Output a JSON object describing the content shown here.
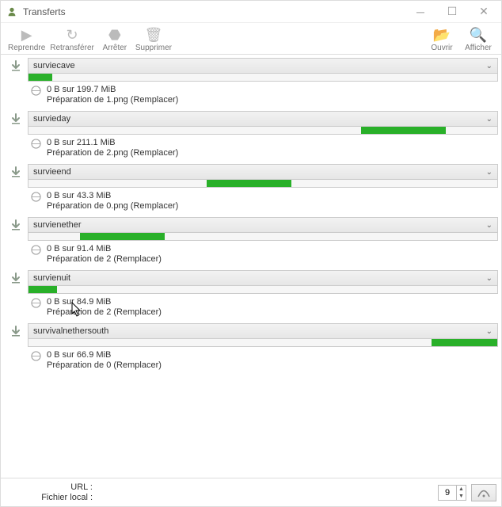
{
  "window": {
    "title": "Transferts"
  },
  "toolbar": {
    "resume": "Reprendre",
    "retransfer": "Retransférer",
    "stop": "Arrêter",
    "delete": "Supprimer",
    "open": "Ouvrir",
    "show": "Afficher"
  },
  "transfers": [
    {
      "name": "surviecave",
      "progress_left_pct": 0,
      "progress_width_pct": 5,
      "status": "0 B sur 199.7 MiB",
      "prep": "Préparation de 1.png (Remplacer)"
    },
    {
      "name": "survieday",
      "progress_left_pct": 71,
      "progress_width_pct": 18,
      "status": "0 B sur 211.1 MiB",
      "prep": "Préparation de 2.png (Remplacer)"
    },
    {
      "name": "survieend",
      "progress_left_pct": 38,
      "progress_width_pct": 18,
      "status": "0 B sur 43.3 MiB",
      "prep": "Préparation de 0.png (Remplacer)"
    },
    {
      "name": "survienether",
      "progress_left_pct": 11,
      "progress_width_pct": 18,
      "status": "0 B sur 91.4 MiB",
      "prep": "Préparation de 2 (Remplacer)"
    },
    {
      "name": "survienuit",
      "progress_left_pct": 0,
      "progress_width_pct": 6,
      "status": "0 B sur 84.9 MiB",
      "prep": "Préparation de 2 (Remplacer)"
    },
    {
      "name": "survivalnethersouth",
      "progress_left_pct": 86,
      "progress_width_pct": 14,
      "status": "0 B sur 66.9 MiB",
      "prep": "Préparation de 0 (Remplacer)"
    }
  ],
  "footer": {
    "url_label": "URL :",
    "file_label": "Fichier local :",
    "stepper_value": "9"
  }
}
